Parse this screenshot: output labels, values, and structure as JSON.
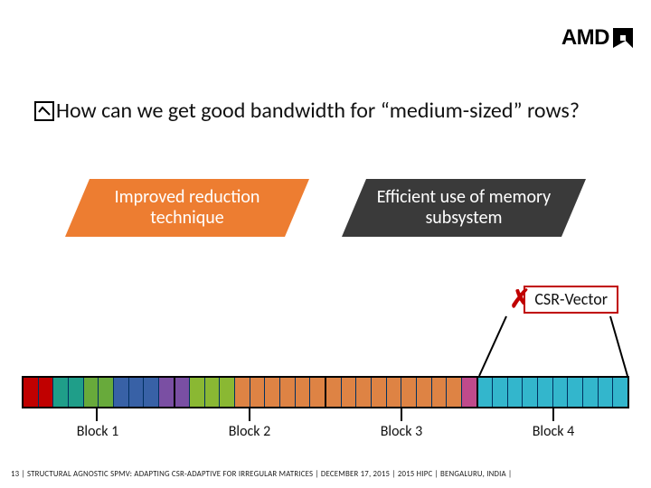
{
  "logo_text": "AMD",
  "question_text": "How can we get good bandwidth for “medium-sized” rows?",
  "pill_left": "Improved reduction technique",
  "pill_right": "Efficient use of memory subsystem",
  "csr_x": "✗",
  "csr_label": "CSR-Vector",
  "block_labels": [
    "Block 1",
    "Block 2",
    "Block 3",
    "Block 4"
  ],
  "block_colors": [
    [
      "#c00000",
      "#c00000",
      "#1f9e89",
      "#1f9e89",
      "#68aa3b",
      "#68aa3b",
      "#3861a6",
      "#3861a6",
      "#3861a6",
      "#7a4fa3"
    ],
    [
      "#7a4fa3",
      "#8ab833",
      "#8ab833",
      "#8ab833",
      "#de8344",
      "#de8344",
      "#de8344",
      "#de8344",
      "#de8344",
      "#de8344"
    ],
    [
      "#de8344",
      "#de8344",
      "#de8344",
      "#de8344",
      "#de8344",
      "#de8344",
      "#de8344",
      "#de8344",
      "#de8344",
      "#c04a8b"
    ],
    [
      "#33b6cc",
      "#33b6cc",
      "#33b6cc",
      "#33b6cc",
      "#33b6cc",
      "#33b6cc",
      "#33b6cc",
      "#33b6cc",
      "#33b6cc",
      "#33b6cc"
    ]
  ],
  "footer": "13  |  STRUCTURAL AGNOSTIC SPMV: ADAPTING CSR-ADAPTIVE FOR IRREGULAR MATRICES  |  DECEMBER 17, 2015  |  2015 HIPC  |  BENGALURU, INDIA  |"
}
